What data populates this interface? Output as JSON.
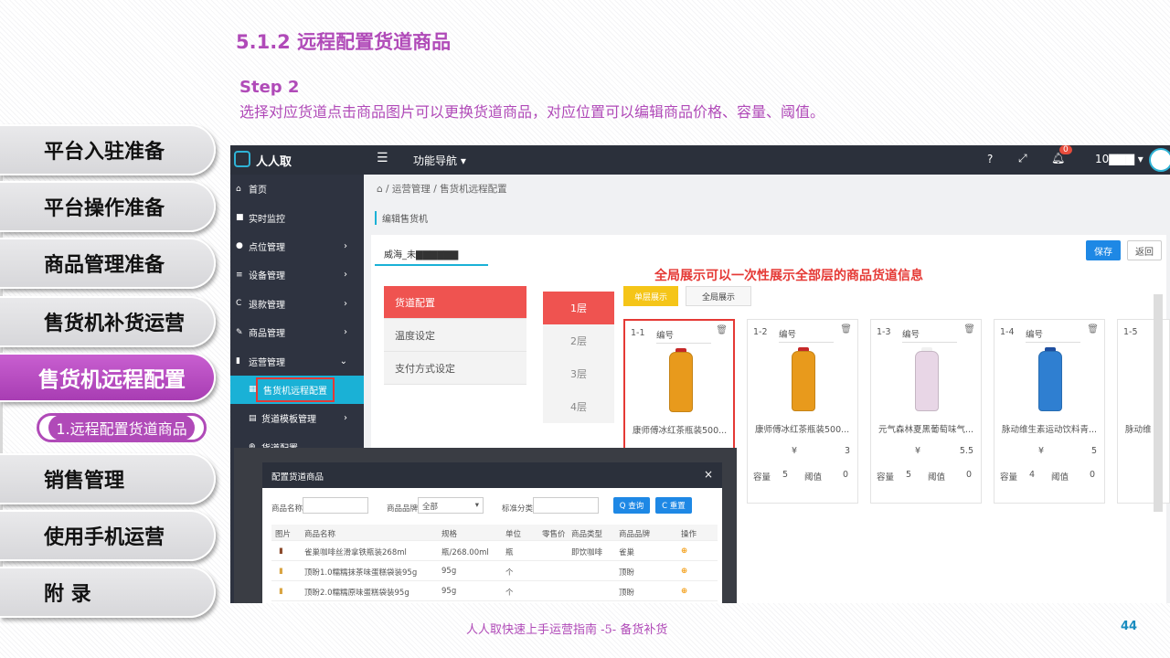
{
  "slide": {
    "title": "5.1.2 远程配置货道商品",
    "step_title": "Step 2",
    "step_desc": "选择对应货道点击商品图片可以更换货道商品，对应位置可以编辑商品价格、容量、阈值。",
    "footer": "人人取快速上手运营指南 -5- 备货补货",
    "page_number": "44"
  },
  "left_nav": {
    "items": [
      "平台入驻准备",
      "平台操作准备",
      "商品管理准备",
      "售货机补货运营",
      "售货机远程配置",
      "销售管理",
      "使用手机运营",
      "附 录"
    ],
    "active_index": 4,
    "sub_item": "1.远程配置货道商品"
  },
  "app": {
    "brand": "人人取",
    "topbar": {
      "func_nav": "功能导航 ▾",
      "help": "?",
      "notification_count": "0",
      "user": "10▇▇▇ ▾"
    },
    "sidebar": [
      {
        "icon": "home-icon",
        "glyph": "⌂",
        "label": "首页",
        "arrow": ""
      },
      {
        "icon": "video-icon",
        "glyph": "■",
        "label": "实时监控",
        "arrow": ""
      },
      {
        "icon": "map-marker-icon",
        "glyph": "●",
        "label": "点位管理",
        "arrow": "›"
      },
      {
        "icon": "device-icon",
        "glyph": "≡",
        "label": "设备管理",
        "arrow": "›"
      },
      {
        "icon": "refund-icon",
        "glyph": "C",
        "label": "退款管理",
        "arrow": "›"
      },
      {
        "icon": "edit-icon",
        "glyph": "✎",
        "label": "商品管理",
        "arrow": "›"
      },
      {
        "icon": "bookmark-icon",
        "glyph": "▮",
        "label": "运营管理",
        "arrow": "⌄"
      },
      {
        "icon": "vending-icon",
        "glyph": "▦",
        "label": "售货机远程配置",
        "arrow": ""
      },
      {
        "icon": "file-icon",
        "glyph": "▤",
        "label": "货道模板管理",
        "arrow": "›"
      },
      {
        "icon": "plus-circle-icon",
        "glyph": "⊕",
        "label": "货道配置",
        "arrow": ""
      }
    ],
    "breadcrumb": "⌂ / 运营管理 / 售货机远程配置",
    "panel_title": "编辑售货机",
    "machine_tab": "威海_未▇▇▇▇▇▇",
    "save_label": "保存",
    "back_label": "返回",
    "annotation": "全局展示可以一次性展示全部层的商品货道信息",
    "config_menu": [
      "货道配置",
      "温度设定",
      "支付方式设定"
    ],
    "layers": [
      "1层",
      "2层",
      "3层",
      "4层"
    ],
    "view_single": "单层展示",
    "view_global": "全局展示",
    "slot_labels": {
      "num": "编号",
      "yen": "¥",
      "capacity": "容量",
      "threshold": "阈值"
    },
    "slots": [
      {
        "id": "1-1",
        "name": "康师傅冰红茶瓶装500...",
        "price": "",
        "capacity": "",
        "threshold": "",
        "color": "#e89a1c",
        "cap_color": "#c62828"
      },
      {
        "id": "1-2",
        "name": "康师傅冰红茶瓶装500...",
        "price": "3",
        "capacity": "5",
        "threshold": "0",
        "color": "#e89a1c",
        "cap_color": "#c62828"
      },
      {
        "id": "1-3",
        "name": "元气森林夏黑葡萄味气...",
        "price": "5.5",
        "capacity": "5",
        "threshold": "0",
        "color": "#e8d6e6",
        "cap_color": "#f0f0f0"
      },
      {
        "id": "1-4",
        "name": "脉动维生素运动饮料青...",
        "price": "5",
        "capacity": "4",
        "threshold": "0",
        "color": "#2f7fd1",
        "cap_color": "#1e4fa0"
      },
      {
        "id": "1-5",
        "name": "脉动维",
        "price": "",
        "capacity": "",
        "threshold": "",
        "color": "#ffffff",
        "cap_color": "#ffffff"
      }
    ]
  },
  "modal": {
    "title": "配置货道商品",
    "close": "×",
    "filters": {
      "name_label": "商品名称",
      "brand_label": "商品品牌",
      "brand_value": "全部",
      "category_label": "标准分类",
      "search_btn": "Q 查询",
      "reset_btn": "C 重置"
    },
    "columns": [
      "图片",
      "商品名称",
      "规格",
      "单位",
      "零售价",
      "商品类型",
      "商品品牌",
      "操作"
    ],
    "rows": [
      {
        "name": "雀巢咖啡丝滑拿铁瓶装268ml",
        "spec": "瓶/268.00ml",
        "unit": "瓶",
        "price": "",
        "type": "即饮咖啡",
        "brand": "雀巢"
      },
      {
        "name": "顶盼1.0糯糯抹茶味蛋糕袋装95g",
        "spec": "95g",
        "unit": "个",
        "price": "",
        "type": "",
        "brand": "顶盼"
      },
      {
        "name": "顶盼2.0糯糯原味蛋糕袋装95g",
        "spec": "95g",
        "unit": "个",
        "price": "",
        "type": "",
        "brand": "顶盼"
      }
    ]
  }
}
